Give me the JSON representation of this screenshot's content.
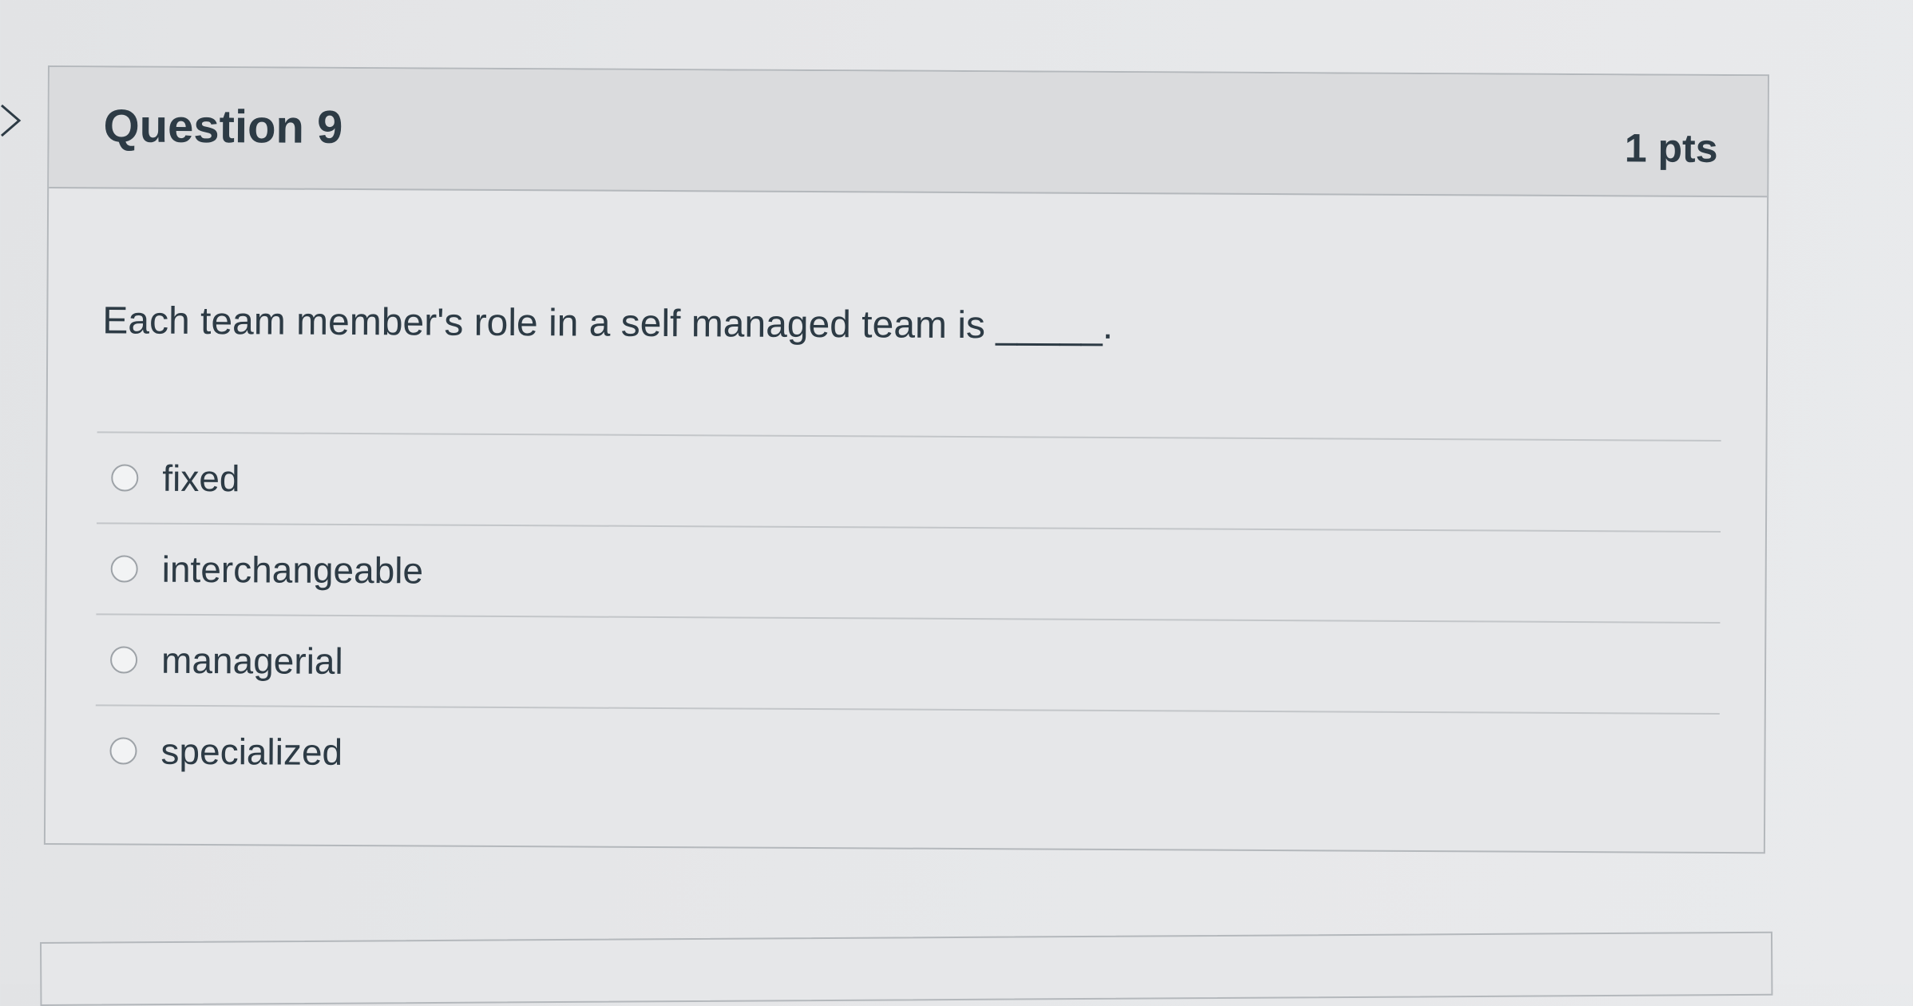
{
  "question": {
    "title": "Question 9",
    "points": "1 pts",
    "text": "Each team member's role in a self managed team is _____.",
    "answers": [
      {
        "label": "fixed"
      },
      {
        "label": "interchangeable"
      },
      {
        "label": "managerial"
      },
      {
        "label": "specialized"
      }
    ]
  },
  "icons": {
    "flag": "chevron-right-icon",
    "radio": "radio-button-icon"
  },
  "colors": {
    "text": "#2d3b45",
    "header_background": "#dadbdd",
    "border": "#b4b8bc"
  }
}
